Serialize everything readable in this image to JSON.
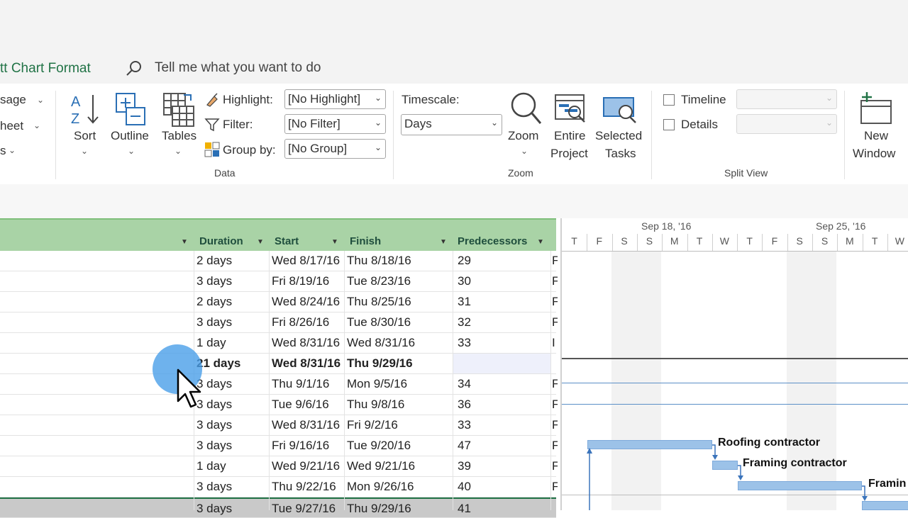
{
  "ribbon": {
    "tab_label": "tt Chart Format",
    "tell_me": "Tell me what you want to do",
    "left_cut": [
      "sage",
      "heet",
      "s"
    ],
    "data_group": {
      "label": "Data",
      "sort": "Sort",
      "outline": "Outline",
      "tables": "Tables",
      "highlight_label": "Highlight:",
      "highlight_value": "[No Highlight]",
      "filter_label": "Filter:",
      "filter_value": "[No Filter]",
      "group_label": "Group by:",
      "group_value": "[No Group]"
    },
    "zoom_group": {
      "label": "Zoom",
      "timescale_label": "Timescale:",
      "timescale_value": "Days",
      "zoom": "Zoom",
      "entire_project_1": "Entire",
      "entire_project_2": "Project",
      "selected_tasks_1": "Selected",
      "selected_tasks_2": "Tasks"
    },
    "split_group": {
      "label": "Split View",
      "timeline": "Timeline",
      "details": "Details"
    },
    "new_window_1": "New",
    "new_window_2": "Window"
  },
  "table": {
    "columns": [
      "Duration",
      "Start",
      "Finish",
      "Predecessors"
    ],
    "rows": [
      {
        "duration": "2 days",
        "start": "Wed 8/17/16",
        "finish": "Thu 8/18/16",
        "pred": "29",
        "res": "F"
      },
      {
        "duration": "3 days",
        "start": "Fri 8/19/16",
        "finish": "Tue 8/23/16",
        "pred": "30",
        "res": "F"
      },
      {
        "duration": "2 days",
        "start": "Wed 8/24/16",
        "finish": "Thu 8/25/16",
        "pred": "31",
        "res": "F"
      },
      {
        "duration": "3 days",
        "start": "Fri 8/26/16",
        "finish": "Tue 8/30/16",
        "pred": "32",
        "res": "F"
      },
      {
        "duration": "1 day",
        "start": "Wed 8/31/16",
        "finish": "Wed 8/31/16",
        "pred": "33",
        "res": "I"
      },
      {
        "duration": "21 days",
        "start": "Wed 8/31/16",
        "finish": "Thu 9/29/16",
        "pred": "",
        "res": ""
      },
      {
        "duration": "3 days",
        "start": "Thu 9/1/16",
        "finish": "Mon 9/5/16",
        "pred": "34",
        "res": "F"
      },
      {
        "duration": "3 days",
        "start": "Tue 9/6/16",
        "finish": "Thu 9/8/16",
        "pred": "36",
        "res": "F"
      },
      {
        "duration": "3 days",
        "start": "Wed 8/31/16",
        "finish": "Fri 9/2/16",
        "pred": "33",
        "res": "F"
      },
      {
        "duration": "3 days",
        "start": "Fri 9/16/16",
        "finish": "Tue 9/20/16",
        "pred": "47",
        "res": "F"
      },
      {
        "duration": "1 day",
        "start": "Wed 9/21/16",
        "finish": "Wed 9/21/16",
        "pred": "39",
        "res": "F"
      },
      {
        "duration": "3 days",
        "start": "Thu 9/22/16",
        "finish": "Mon 9/26/16",
        "pred": "40",
        "res": "F"
      },
      {
        "duration": "3 days",
        "start": "Tue 9/27/16",
        "finish": "Thu 9/29/16",
        "pred": "41",
        "res": ""
      }
    ]
  },
  "gantt": {
    "weeks": [
      "Sep 18, '16",
      "Sep 25, '16"
    ],
    "days": [
      "T",
      "F",
      "S",
      "S",
      "M",
      "T",
      "W",
      "T",
      "F",
      "S",
      "S",
      "M",
      "T",
      "W"
    ],
    "bar_labels": [
      "Roofing contractor",
      "Framing contractor",
      "Framin"
    ]
  },
  "colors": {
    "accent": "#217346",
    "header_green": "#a9d3a6",
    "bar_blue": "#9cc2e8",
    "cursor_highlight": "#4a9fe8"
  }
}
